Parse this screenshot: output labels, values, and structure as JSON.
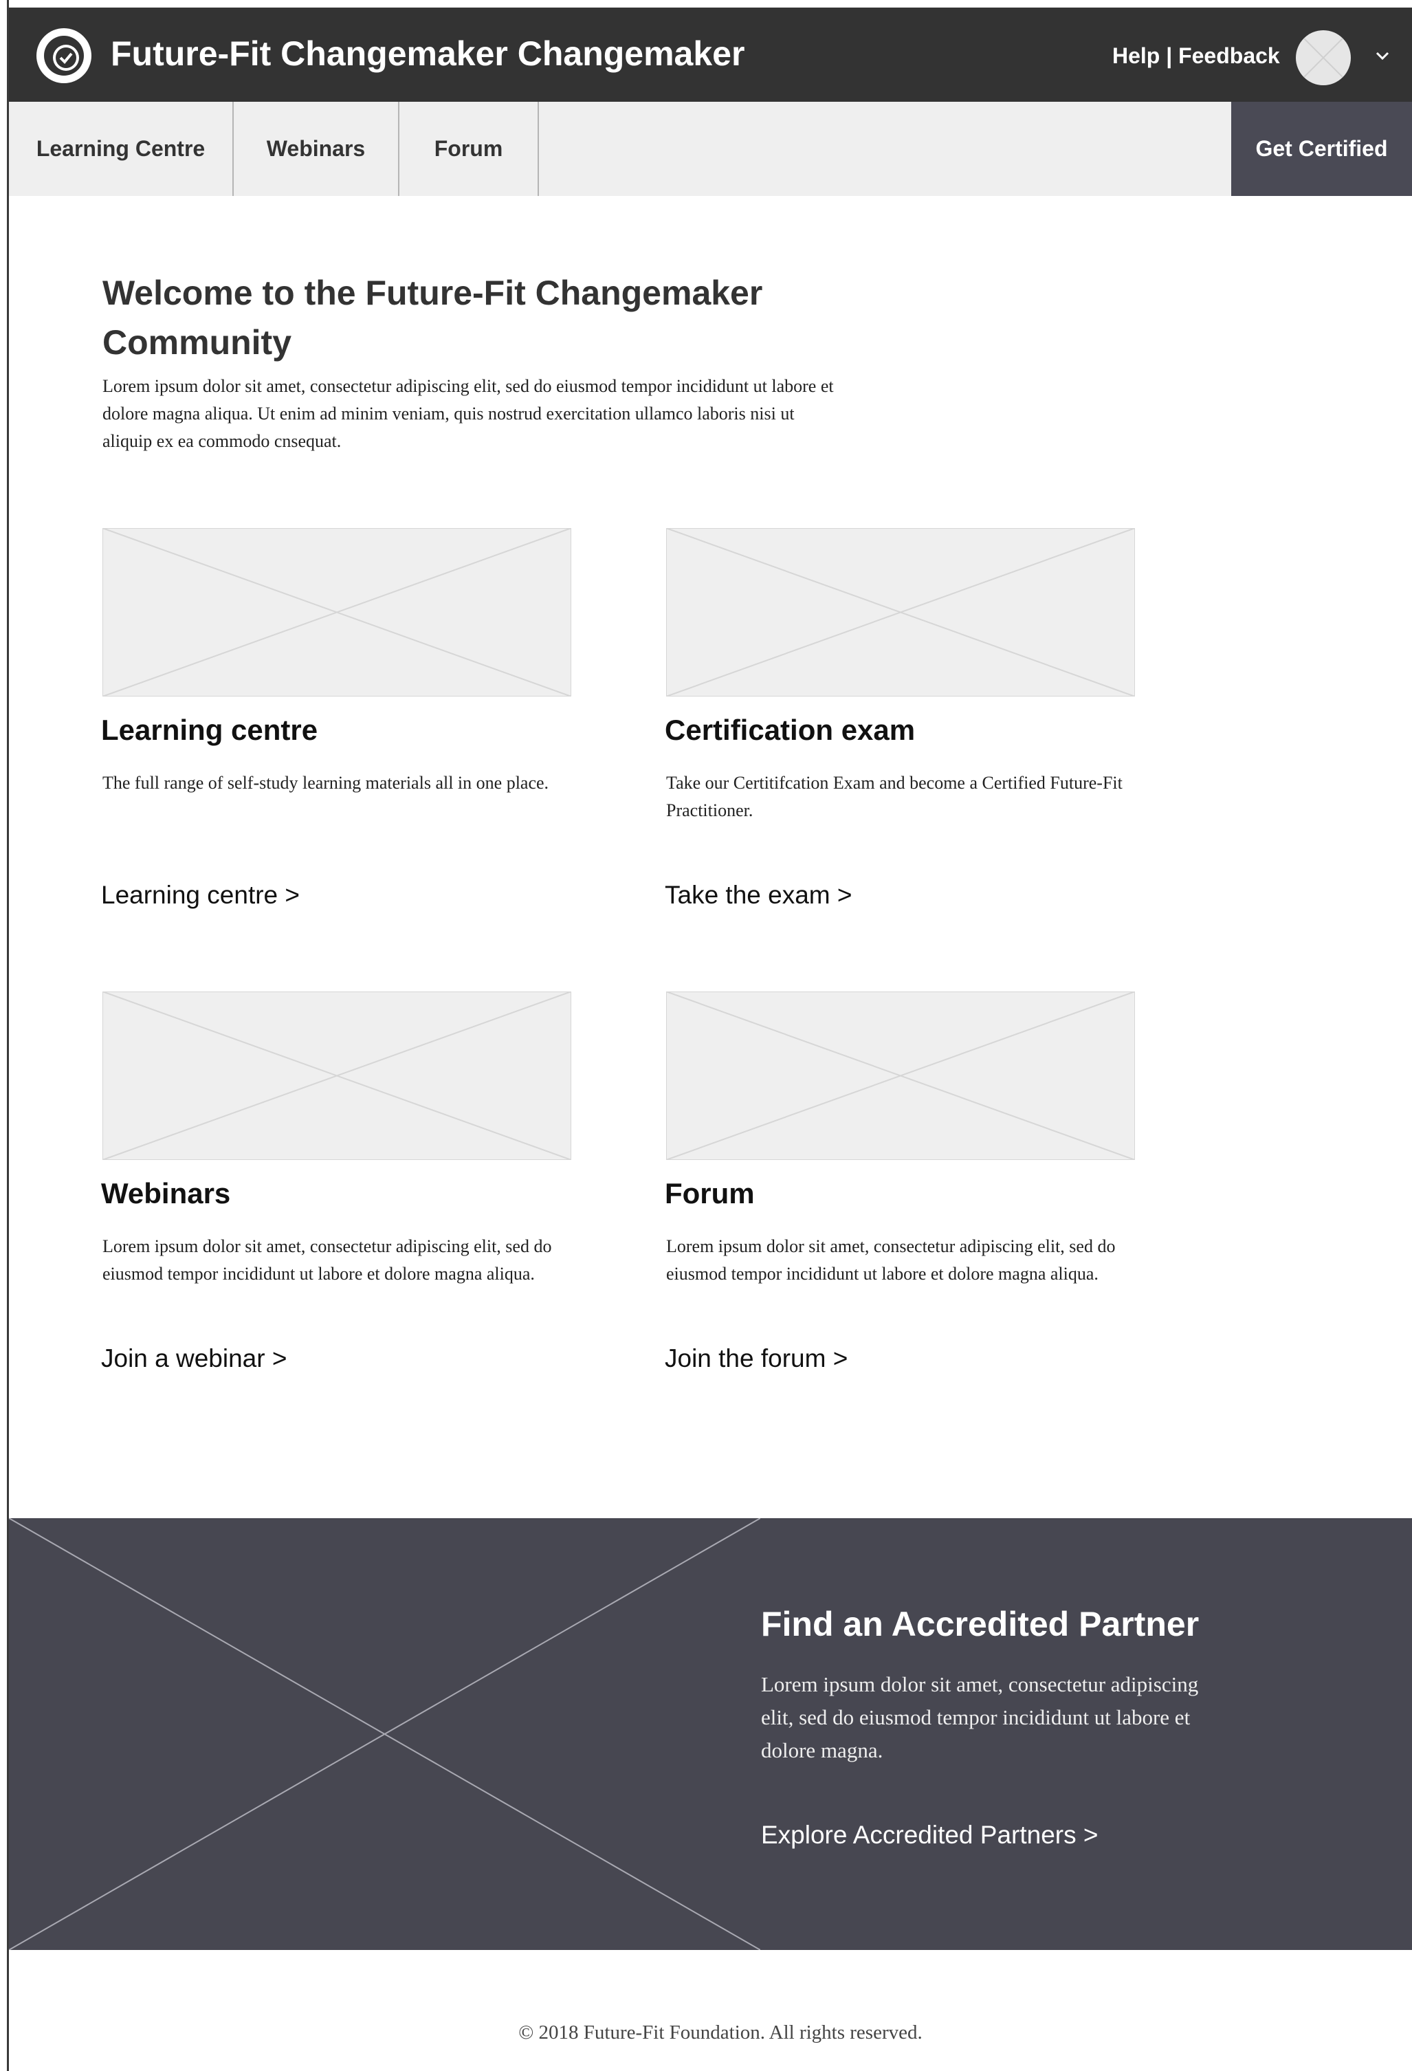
{
  "header": {
    "app_title": "Future-Fit Changemaker Changemaker",
    "help_label": "Help",
    "separator": "|",
    "feedback_label": "Feedback",
    "colors": {
      "bar": "#333333",
      "text": "#ffffff"
    }
  },
  "nav": {
    "items": [
      {
        "label": "Learning Centre"
      },
      {
        "label": "Webinars"
      },
      {
        "label": "Forum"
      }
    ],
    "cta_label": "Get Certified",
    "colors": {
      "bar": "#efefef",
      "cta": "#4a4a55"
    }
  },
  "welcome": {
    "title": "Welcome to the Future-Fit Changemaker Community",
    "body": "Lorem ipsum dolor sit amet, consectetur adipiscing elit, sed do eiusmod tempor incididunt ut labore et dolore magna aliqua. Ut enim ad minim veniam, quis nostrud exercitation ullamco laboris nisi ut aliquip ex ea commodo cnsequat."
  },
  "cards": [
    {
      "title": "Learning centre",
      "description": "The full range of self-study learning materials all in one place.",
      "link": "Learning centre >"
    },
    {
      "title": "Certification exam",
      "description": "Take our Certitifcation Exam and become a Certified Future-Fit Practitioner.",
      "link": "Take the exam >"
    },
    {
      "title": "Webinars",
      "description": "Lorem ipsum dolor sit amet, consectetur adipiscing elit, sed do eiusmod tempor incididunt ut labore et dolore magna aliqua.",
      "link": "Join a webinar >"
    },
    {
      "title": "Forum",
      "description": "Lorem ipsum dolor sit amet, consectetur adipiscing elit, sed do eiusmod tempor incididunt ut labore et dolore magna aliqua.",
      "link": "Join the forum >"
    }
  ],
  "partner": {
    "title": "Find an Accredited Partner",
    "description": "Lorem ipsum dolor sit amet, consectetur adipiscing elit, sed do eiusmod tempor incididunt ut labore et dolore magna.",
    "link": "Explore Accredited Partners >",
    "colors": {
      "band": "#474751"
    }
  },
  "footer": {
    "copyright": "© 2018 Future-Fit Foundation. All rights reserved."
  }
}
